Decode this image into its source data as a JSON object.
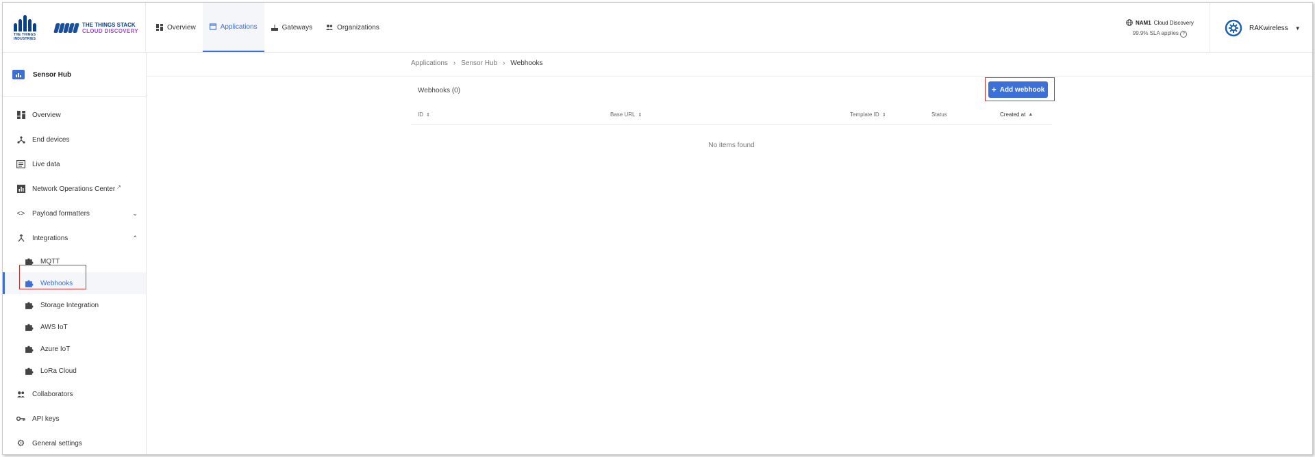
{
  "header": {
    "tti_logo_text": "THE THINGS INDUSTRIES",
    "product_line1": "THE THINGS STACK",
    "product_line2": "CLOUD DISCOVERY",
    "nav": [
      {
        "label": "Overview",
        "icon": "grid-icon",
        "active": false
      },
      {
        "label": "Applications",
        "icon": "window-icon",
        "active": true
      },
      {
        "label": "Gateways",
        "icon": "gateway-icon",
        "active": false
      },
      {
        "label": "Organizations",
        "icon": "people-icon",
        "active": false
      }
    ],
    "cluster_name": "NAM1",
    "cluster_label": "Cloud Discovery",
    "sla": "99.9% SLA applies",
    "user": "RAKwireless"
  },
  "sidebar": {
    "app_name": "Sensor Hub",
    "items": [
      {
        "label": "Overview"
      },
      {
        "label": "End devices"
      },
      {
        "label": "Live data"
      },
      {
        "label": "Network Operations Center"
      },
      {
        "label": "Payload formatters"
      },
      {
        "label": "Integrations"
      }
    ],
    "integrations": [
      {
        "label": "MQTT"
      },
      {
        "label": "Webhooks"
      },
      {
        "label": "Storage Integration"
      },
      {
        "label": "AWS IoT"
      },
      {
        "label": "Azure IoT"
      },
      {
        "label": "LoRa Cloud"
      }
    ],
    "bottom": [
      {
        "label": "Collaborators"
      },
      {
        "label": "API keys"
      },
      {
        "label": "General settings"
      }
    ]
  },
  "breadcrumb": [
    "Applications",
    "Sensor Hub",
    "Webhooks"
  ],
  "section_title": "Webhooks (0)",
  "add_button": "Add webhook",
  "table": {
    "columns": [
      "ID",
      "Base URL",
      "Template ID",
      "Status",
      "Created at"
    ],
    "empty_text": "No items found"
  },
  "colors": {
    "accent": "#3c6fd8",
    "highlight": "#d32f2f"
  }
}
